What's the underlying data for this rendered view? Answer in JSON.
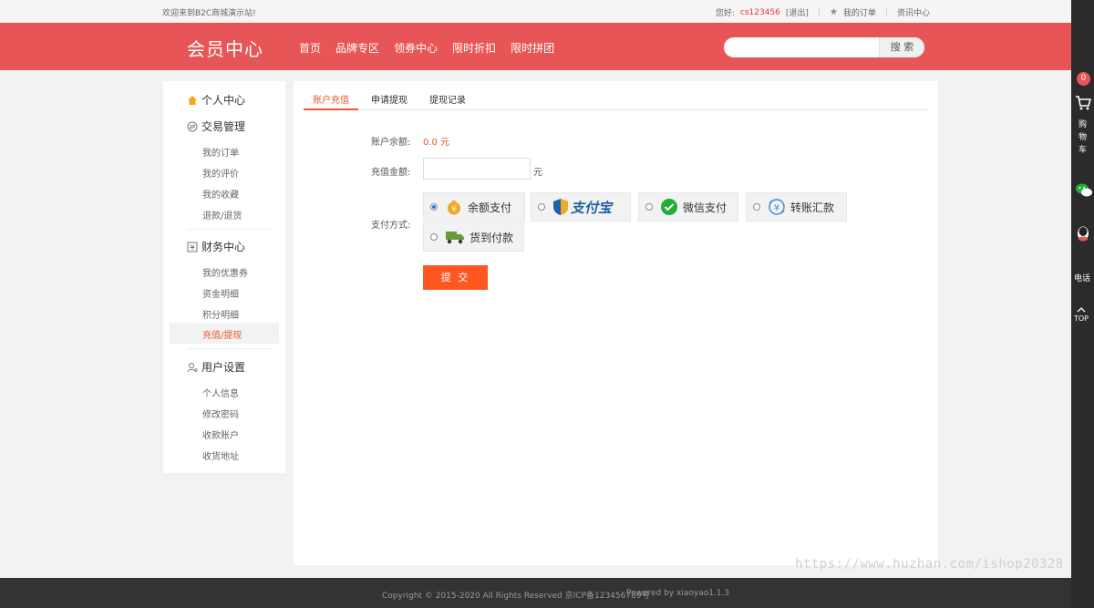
{
  "topbar": {
    "welcome": "欢迎来到B2C商城演示站!",
    "greeting": "您好:",
    "username": "cs123456",
    "logout": "[退出]",
    "my_orders": "我的订单",
    "news": "资讯中心"
  },
  "header": {
    "title": "会员中心",
    "nav": [
      "首页",
      "品牌专区",
      "领券中心",
      "限时折扣",
      "限时拼团"
    ],
    "search_placeholder": "",
    "search_button": "搜 索"
  },
  "sidebar": {
    "personal_center": "个人中心",
    "trade": {
      "title": "交易管理",
      "items": [
        "我的订单",
        "我的评价",
        "我的收藏",
        "退款/退货"
      ]
    },
    "finance": {
      "title": "财务中心",
      "items": [
        "我的优惠券",
        "资金明细",
        "积分明细",
        "充值/提现"
      ]
    },
    "user": {
      "title": "用户设置",
      "items": [
        "个人信息",
        "修改密码",
        "收款账户",
        "收货地址"
      ]
    }
  },
  "tabs": [
    "账户充值",
    "申请提现",
    "提现记录"
  ],
  "form": {
    "balance_label": "账户余额:",
    "balance_value": "0.0 元",
    "amount_label": "充值金额:",
    "amount_value": "",
    "unit": "元",
    "method_label": "支付方式:",
    "methods": [
      {
        "name": "余额支付",
        "selected": true,
        "icon": "money-bag-icon"
      },
      {
        "name": "支付宝",
        "selected": false,
        "icon": "alipay-logo"
      },
      {
        "name": "微信支付",
        "selected": false,
        "icon": "wechat-pay-icon"
      },
      {
        "name": "转账汇款",
        "selected": false,
        "icon": "transfer-icon"
      },
      {
        "name": "货到付款",
        "selected": false,
        "icon": "truck-icon"
      }
    ],
    "submit": "提 交"
  },
  "rail": {
    "cart_count": "0",
    "cart_label": "购物车",
    "phone_label": "电话",
    "top_label": "TOP"
  },
  "footer": {
    "copyright": "Copyright © 2015-2020 All Rights Reserved 京ICP备123456789号",
    "powered": "Powered by xiaoyao1.1.3"
  },
  "watermark": "https://www.huzhan.com/ishop20328",
  "colors": {
    "brand": "#e85556",
    "accent": "#e85a2b",
    "submit": "#ff5722"
  }
}
